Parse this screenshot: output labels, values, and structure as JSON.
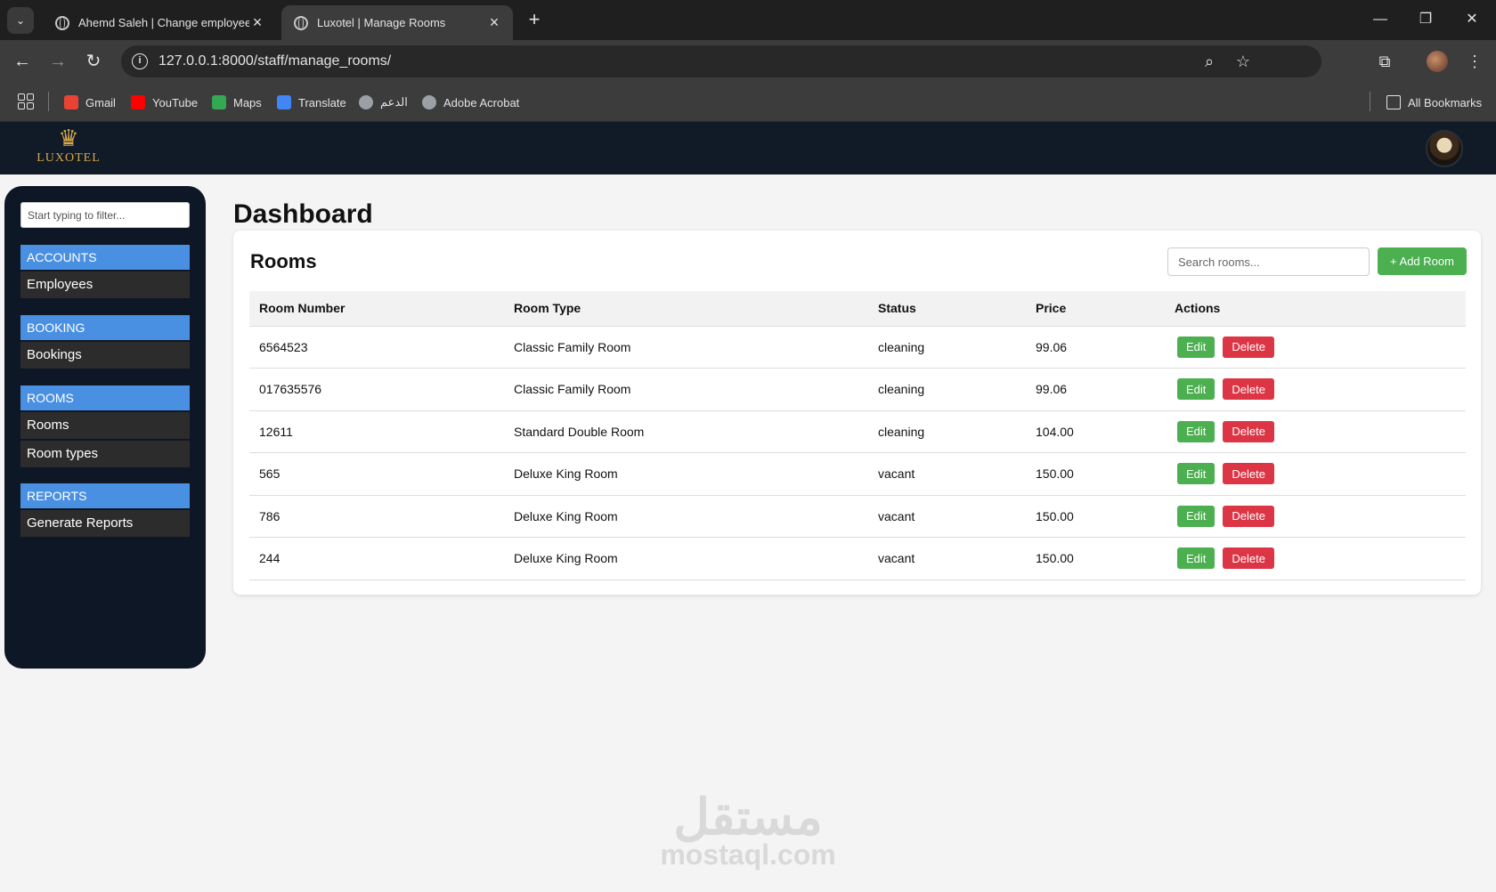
{
  "browser": {
    "tabs": [
      {
        "title": "Ahemd Saleh | Change employee | Django site admin",
        "active": false
      },
      {
        "title": "Luxotel | Manage Rooms",
        "active": true
      }
    ],
    "url": "127.0.0.1:8000/staff/manage_rooms/",
    "bookmarks": [
      {
        "label": "Gmail",
        "icon": "gmail-icon",
        "color": "#ea4335"
      },
      {
        "label": "YouTube",
        "icon": "youtube-icon",
        "color": "#ff0000"
      },
      {
        "label": "Maps",
        "icon": "maps-icon",
        "color": "#34a853"
      },
      {
        "label": "Translate",
        "icon": "translate-icon",
        "color": "#4285f4"
      },
      {
        "label": "الدعم",
        "icon": "globe-icon",
        "color": "#9aa0a6"
      },
      {
        "label": "Adobe Acrobat",
        "icon": "globe-icon",
        "color": "#9aa0a6"
      }
    ],
    "all_bookmarks": "All Bookmarks"
  },
  "site": {
    "brand": "LUXOTEL",
    "accent": "#d6a84a",
    "header_bg": "#111a27"
  },
  "sidebar": {
    "filter_placeholder": "Start typing to filter...",
    "sections": [
      {
        "header": "ACCOUNTS",
        "items": [
          "Employees"
        ]
      },
      {
        "header": "BOOKING",
        "items": [
          "Bookings"
        ]
      },
      {
        "header": "ROOMS",
        "items": [
          "Rooms",
          "Room types"
        ]
      },
      {
        "header": "REPORTS",
        "items": [
          "Generate Reports"
        ]
      }
    ],
    "section_color": "#4a90e2"
  },
  "main": {
    "page_title": "Dashboard",
    "card_title": "Rooms",
    "search_placeholder": "Search rooms...",
    "add_button": "+ Add Room",
    "columns": [
      "Room Number",
      "Room Type",
      "Status",
      "Price",
      "Actions"
    ],
    "rows": [
      {
        "number": "6564523",
        "type": "Classic Family Room",
        "status": "cleaning",
        "price": "99.06"
      },
      {
        "number": "017635576",
        "type": "Classic Family Room",
        "status": "cleaning",
        "price": "99.06"
      },
      {
        "number": "12611",
        "type": "Standard Double Room",
        "status": "cleaning",
        "price": "104.00"
      },
      {
        "number": "565",
        "type": "Deluxe King Room",
        "status": "vacant",
        "price": "150.00"
      },
      {
        "number": "786",
        "type": "Deluxe King Room",
        "status": "vacant",
        "price": "150.00"
      },
      {
        "number": "244",
        "type": "Deluxe King Room",
        "status": "vacant",
        "price": "150.00"
      }
    ],
    "edit_label": "Edit",
    "delete_label": "Delete",
    "edit_color": "#4caf50",
    "delete_color": "#dc3545"
  },
  "watermark": {
    "arabic": "مستقل",
    "latin": "mostaql.com"
  }
}
